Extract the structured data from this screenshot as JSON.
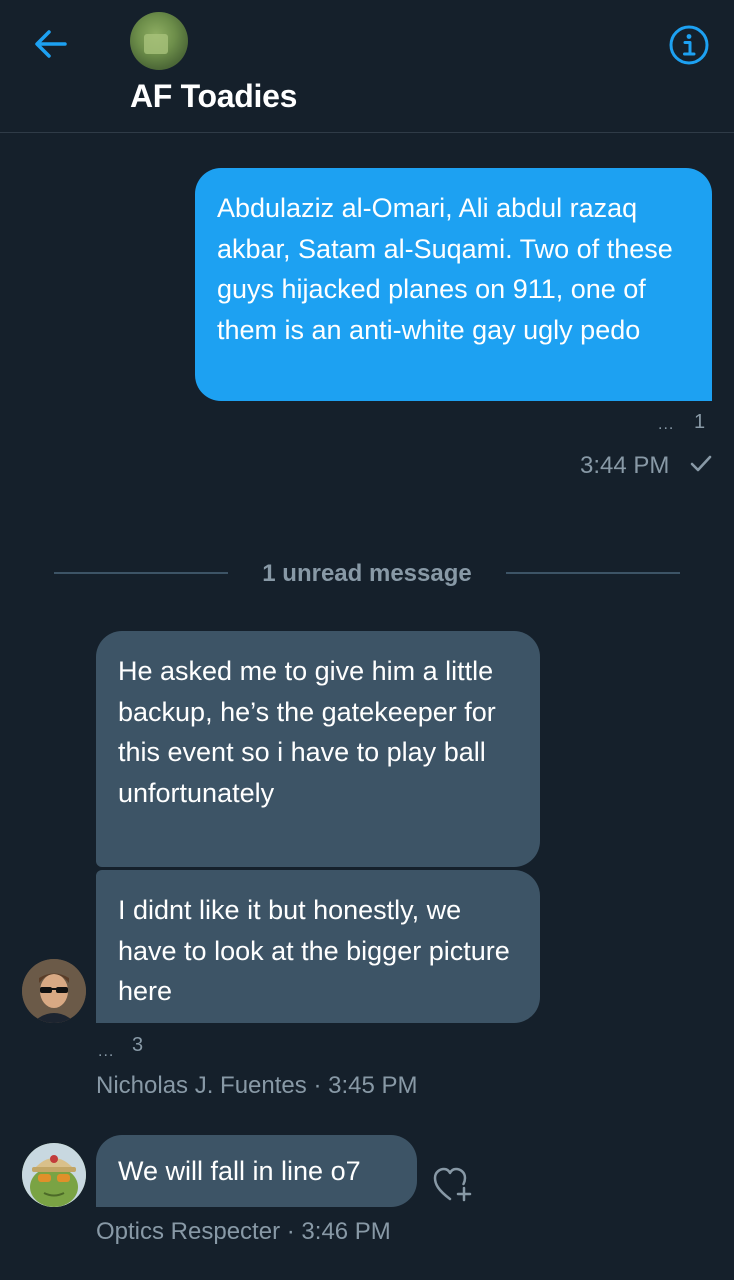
{
  "header": {
    "title": "AF Toadies",
    "back_icon": "arrow-left-icon",
    "info_icon": "info-icon"
  },
  "colors": {
    "background": "#15202b",
    "accent": "#1da1f2",
    "incoming_bubble": "#3d5466",
    "meta_text": "#8899a6"
  },
  "messages": {
    "outgoing": {
      "text": "Abdulaziz al-Omari, Ali abdul razaq akbar, Satam al-Suqami. Two of these guys hijacked planes on 911, one of them is an anti-white gay ugly pedo",
      "reaction_count": "1",
      "time": "3:44 PM",
      "status_icon": "checkmark-icon"
    },
    "unread_divider": "1 unread message",
    "incoming_group_1": {
      "bubbles": [
        "He asked me to give him a little backup, he’s the gatekeeper for this event so i have to play ball unfortunately",
        "I didnt like it but honestly, we have to look at the bigger picture here"
      ],
      "reaction_count": "3",
      "sender": "Nicholas J. Fuentes",
      "separator": "·",
      "time": "3:45 PM"
    },
    "incoming_group_2": {
      "bubble": "We will fall in line o7",
      "sender": "Optics Respecter",
      "separator": "·",
      "time": "3:46 PM",
      "like_icon": "heart-plus-icon"
    }
  }
}
